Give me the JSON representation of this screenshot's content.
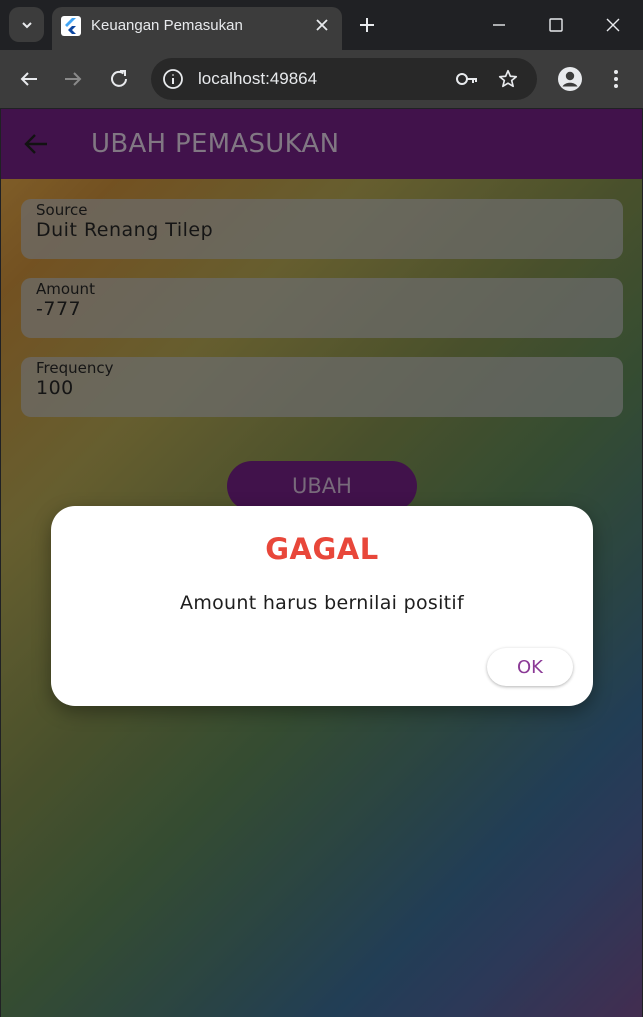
{
  "browser": {
    "tab_title": "Keuangan Pemasukan",
    "url": "localhost:49864"
  },
  "app": {
    "title": "UBAH PEMASUKAN",
    "fields": [
      {
        "label": "Source",
        "value": "Duit Renang Tilep"
      },
      {
        "label": "Amount",
        "value": "-777"
      },
      {
        "label": "Frequency",
        "value": "100"
      }
    ],
    "submit_label": "UBAH"
  },
  "dialog": {
    "title": "GAGAL",
    "message": "Amount harus bernilai positif",
    "ok_label": "OK"
  },
  "colors": {
    "appbar": "#5a1a68",
    "dialog_title": "#e8473a",
    "ok_text": "#8b3a96"
  }
}
